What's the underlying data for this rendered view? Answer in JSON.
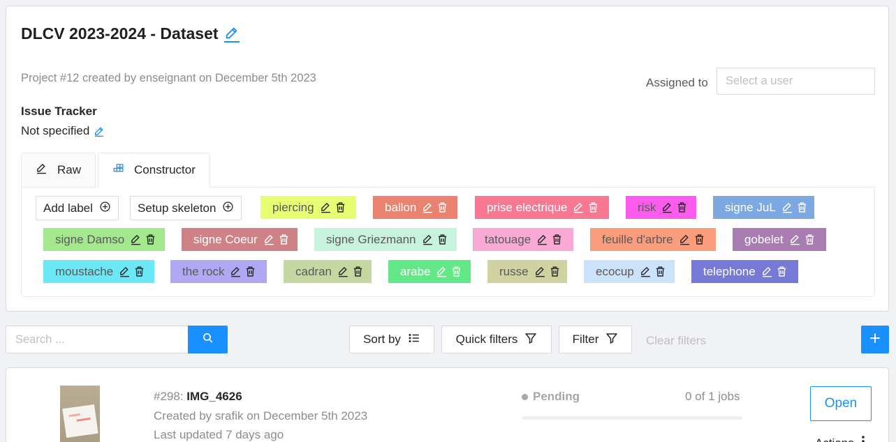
{
  "project": {
    "title": "DLCV 2023-2024 - Dataset",
    "subtitle": "Project #12 created by enseignant on December 5th 2023",
    "assigned_label": "Assigned to",
    "assigned_placeholder": "Select a user",
    "issue_tracker_title": "Issue Tracker",
    "issue_tracker_value": "Not specified"
  },
  "tabs": [
    {
      "label": "Raw",
      "icon": "edit-icon",
      "active": false
    },
    {
      "label": "Constructor",
      "icon": "build-icon",
      "active": true
    }
  ],
  "constructor": {
    "add_label": "Add label",
    "setup_skeleton": "Setup skeleton",
    "labels": [
      {
        "name": "piercing",
        "color": "#e8fd71",
        "text_color": "#595959"
      },
      {
        "name": "ballon",
        "color": "#e9826f",
        "text_color": "#ffffff"
      },
      {
        "name": "prise electrique",
        "color": "#f87893",
        "text_color": "#ffffff"
      },
      {
        "name": "risk",
        "color": "#fd5bee",
        "text_color": "#595959"
      },
      {
        "name": "signe JuL",
        "color": "#7ca9e2",
        "text_color": "#ffffff"
      },
      {
        "name": "signe Damso",
        "color": "#a3e88d",
        "text_color": "#595959"
      },
      {
        "name": "signe Coeur",
        "color": "#cf8285",
        "text_color": "#ffffff"
      },
      {
        "name": "signe Griezmann",
        "color": "#c7f2de",
        "text_color": "#595959"
      },
      {
        "name": "tatouage",
        "color": "#f9a9d3",
        "text_color": "#595959"
      },
      {
        "name": "feuille d'arbre",
        "color": "#fb9c7d",
        "text_color": "#595959"
      },
      {
        "name": "gobelet",
        "color": "#a77eaf",
        "text_color": "#ffffff"
      },
      {
        "name": "moustache",
        "color": "#6ae8f6",
        "text_color": "#595959"
      },
      {
        "name": "the rock",
        "color": "#b0a8f2",
        "text_color": "#595959"
      },
      {
        "name": "cadran",
        "color": "#c6d8a1",
        "text_color": "#595959"
      },
      {
        "name": "arabe",
        "color": "#62e887",
        "text_color": "#ffffff"
      },
      {
        "name": "russe",
        "color": "#d0d2a1",
        "text_color": "#595959"
      },
      {
        "name": "ecocup",
        "color": "#cce2fa",
        "text_color": "#595959"
      },
      {
        "name": "telephone",
        "color": "#7779d6",
        "text_color": "#ffffff"
      }
    ]
  },
  "toolbar": {
    "search_placeholder": "Search ...",
    "sort_by": "Sort by",
    "quick_filters": "Quick filters",
    "filter": "Filter",
    "clear_filters": "Clear filters"
  },
  "task": {
    "id": "#298:",
    "name": "IMG_4626",
    "created": "Created by srafik on December 5th 2023",
    "updated": "Last updated 7 days ago",
    "status": "Pending",
    "jobs": "0 of 1 jobs",
    "progress": 0,
    "open": "Open",
    "actions": "Actions"
  },
  "colors": {
    "accent": "#1890ff"
  }
}
